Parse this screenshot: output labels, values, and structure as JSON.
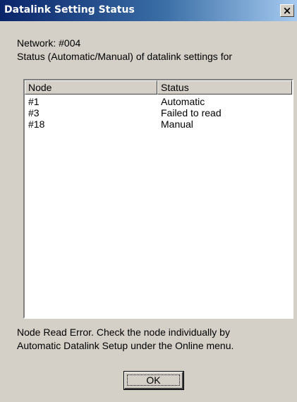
{
  "window": {
    "title": "Datalink Setting Status",
    "close_glyph": "×"
  },
  "header": {
    "network_line": "Network: #004",
    "description_line": "Status (Automatic/Manual) of datalink settings for"
  },
  "table": {
    "columns": [
      "Node",
      "Status"
    ],
    "rows": [
      {
        "node": "#1",
        "status": "Automatic"
      },
      {
        "node": "#3",
        "status": "Failed to read"
      },
      {
        "node": "#18",
        "status": "Manual"
      }
    ]
  },
  "footer": {
    "message_line1": "Node Read Error. Check the node individually by",
    "message_line2": "Automatic Datalink Setup under the Online menu."
  },
  "buttons": {
    "ok_label": "OK"
  },
  "colors": {
    "titlebar_start": "#0a246a",
    "titlebar_end": "#a6caf0",
    "dialog_face": "#d4d0c8"
  }
}
